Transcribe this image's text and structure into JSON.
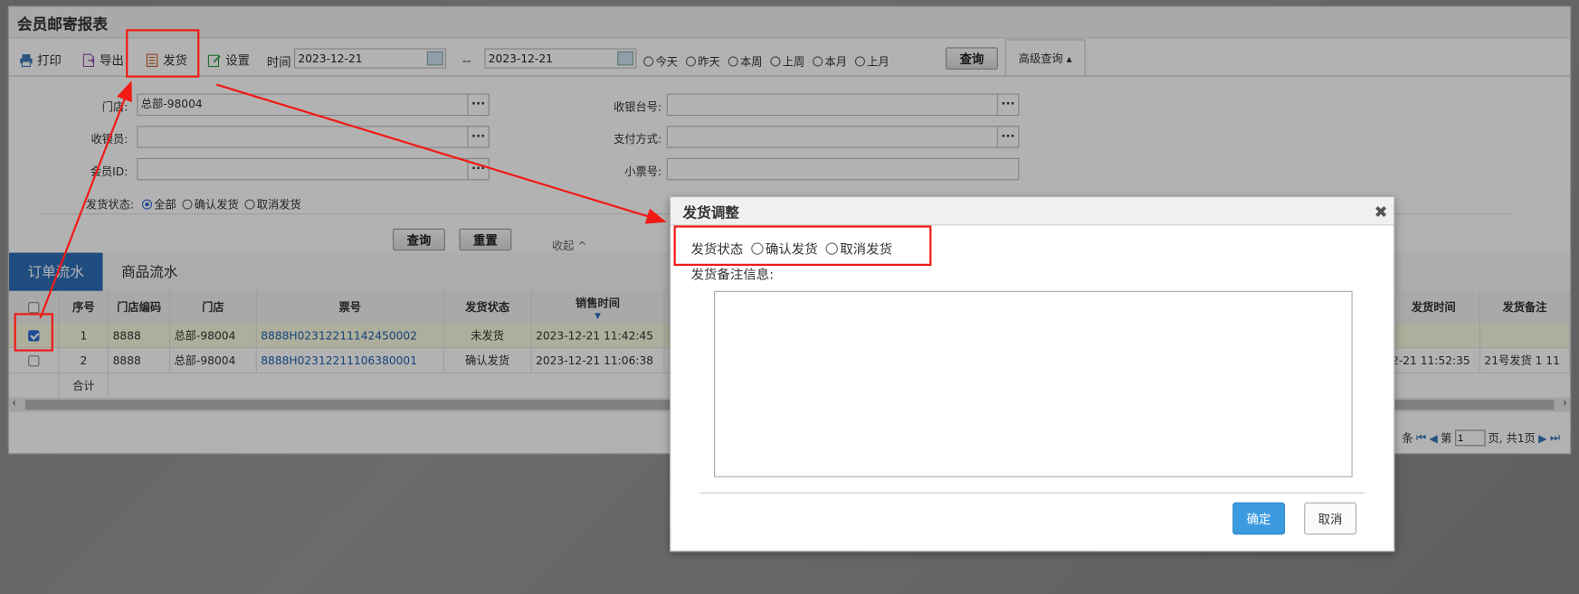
{
  "page": {
    "title": "会员邮寄报表"
  },
  "toolbar": {
    "print": "打印",
    "export": "导出",
    "ship": "发货",
    "settings": "设置",
    "time_label": "时间",
    "date_from": "2023-12-21",
    "date_sep": "--",
    "date_to": "2023-12-21",
    "quick_ranges": [
      "今天",
      "昨天",
      "本周",
      "上周",
      "本月",
      "上月"
    ],
    "query": "查询",
    "advanced": "高级查询 ▴"
  },
  "filters": {
    "store_label": "门店:",
    "store_value": "总部-98004",
    "cashier_label": "收银员:",
    "member_label": "会员ID:",
    "register_label": "收银台号:",
    "payment_label": "支付方式:",
    "ticket_label": "小票号:",
    "status_label": "发货状态:",
    "status_options": [
      "全部",
      "确认发货",
      "取消发货"
    ],
    "query": "查询",
    "reset": "重置",
    "collapse": "收起 ^"
  },
  "tabs": [
    "订单流水",
    "商品流水"
  ],
  "grid": {
    "headers": [
      "序号",
      "门店编码",
      "门店",
      "票号",
      "发货状态",
      "销售时间",
      "发货时间",
      "发货备注"
    ],
    "rows": [
      {
        "no": "1",
        "store_code": "8888",
        "store": "总部-98004",
        "ticket": "8888H02312211142450002",
        "status": "未发货",
        "sale_time": "2023-12-21 11:42:45",
        "ship_time": "",
        "note": ""
      },
      {
        "no": "2",
        "store_code": "8888",
        "store": "总部-98004",
        "ticket": "8888H02312211106380001",
        "status": "确认发货",
        "sale_time": "2023-12-21 11:06:38",
        "ship_time": "2-21 11:52:35",
        "note": "21号发货 1 11"
      }
    ],
    "total_label": "合计"
  },
  "pager": {
    "prefix": "条",
    "page_label": "第",
    "page_value": "1",
    "suffix": "页, 共1页"
  },
  "dialog": {
    "title": "发货调整",
    "close": "✖",
    "status_label": "发货状态",
    "options": [
      "确认发货",
      "取消发货"
    ],
    "note_label": "发货备注信息:",
    "confirm": "确定",
    "cancel": "取消"
  },
  "colors": {
    "accent": "#2f6fb8",
    "highlight": "#f01b16",
    "confirm": "#3c9be0"
  }
}
